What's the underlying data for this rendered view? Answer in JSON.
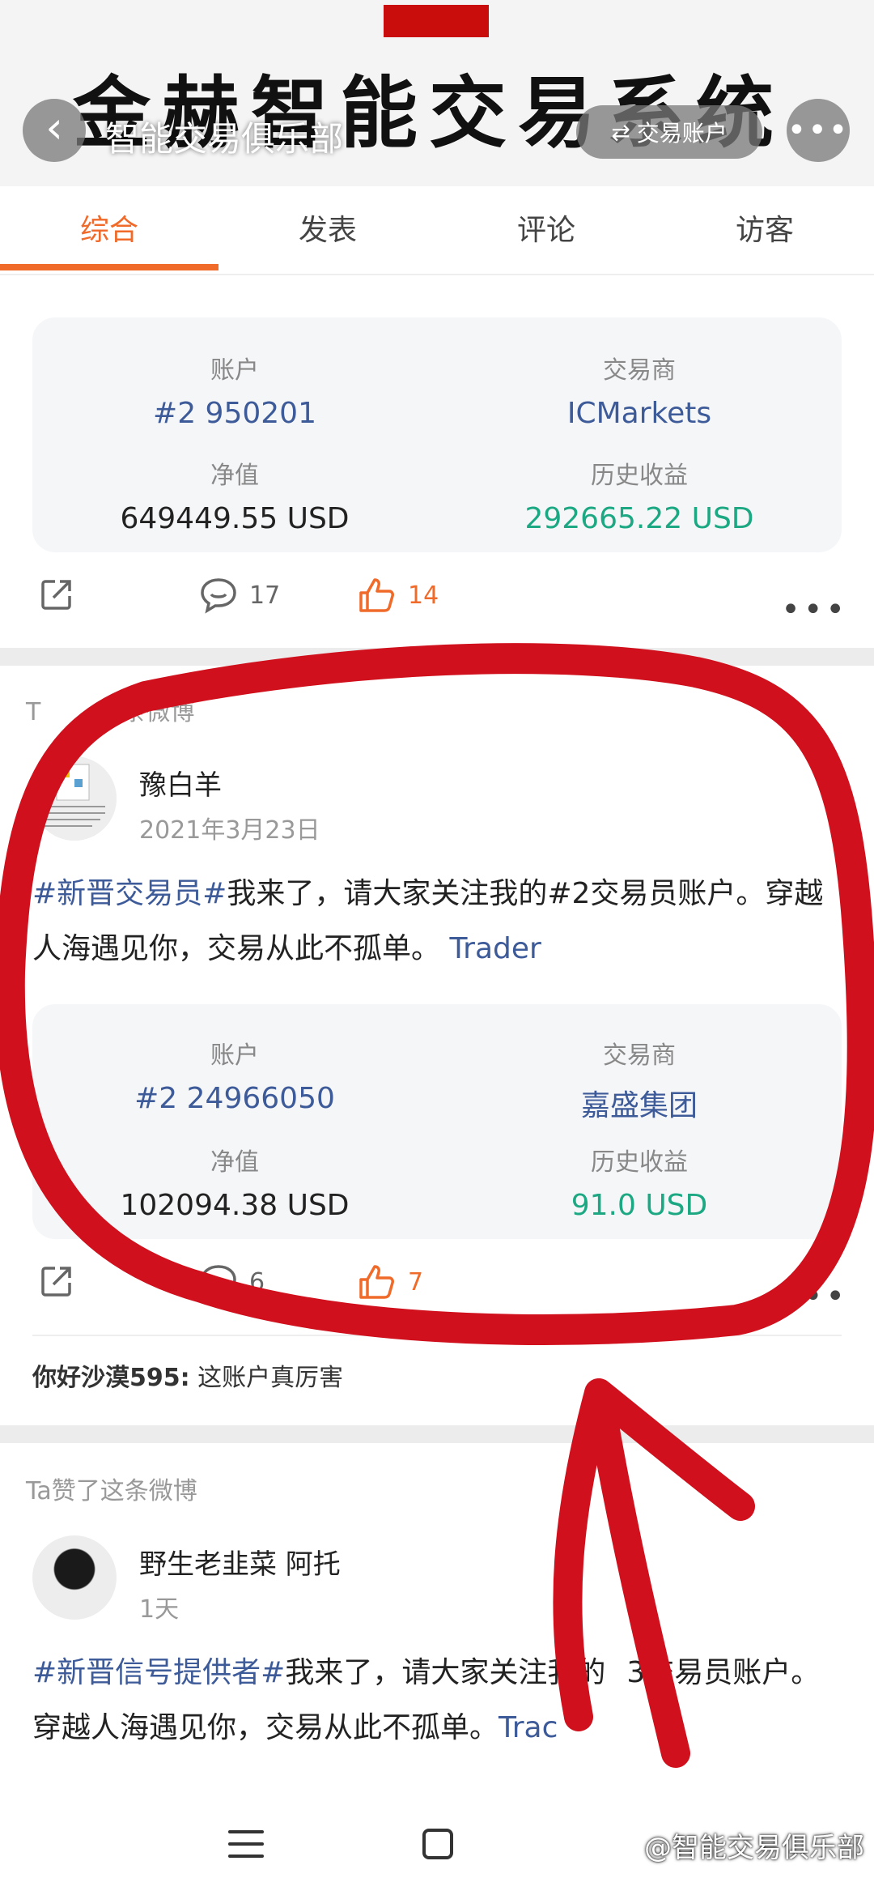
{
  "header": {
    "banner": "金赫智能交易系统",
    "title": "智能交易俱乐部",
    "switch_label": "交易账户"
  },
  "tabs": [
    "综合",
    "发表",
    "评论",
    "访客"
  ],
  "post1_card": {
    "account_label": "账户",
    "account": "#2 950201",
    "broker_label": "交易商",
    "broker": "ICMarkets",
    "equity_label": "净值",
    "equity": "649449.55 USD",
    "profit_label": "历史收益",
    "profit": "292665.22 USD"
  },
  "post1_actions": {
    "comments": "17",
    "likes": "14"
  },
  "post2": {
    "meta": "Ta赞了这条微博",
    "meta_visible_start": "T",
    "meta_visible_end": "这条微博",
    "user": "豫白羊",
    "date": "2021年3月23日",
    "tag": "#新晋交易员#",
    "text": "我来了，请大家关注我的#2交易员账户。穿越人海遇见你，交易从此不孤单。",
    "link": "Trader",
    "card": {
      "account_label": "账户",
      "account": "#2 24966050",
      "broker_label": "交易商",
      "broker": "嘉盛集团",
      "equity_label": "净值",
      "equity": "102094.38 USD",
      "profit_label": "历史收益",
      "profit": "91.0 USD"
    },
    "comments": "6",
    "likes": "7",
    "comment_user": "你好沙漠595:",
    "comment_text": "这账户真厉害"
  },
  "post3": {
    "meta": "Ta赞了这条微博",
    "user": "野生老韭菜 阿托",
    "date": "1天",
    "tag": "#新晋信号提供者#",
    "text": "我来了，请大家关注我的",
    "text2": "3交易员账户。穿越人海遇见你，交易从此不孤单。",
    "link": "Trac"
  },
  "watermark": "@智能交易俱乐部",
  "colors": {
    "accent": "#f06a2a",
    "link": "#3d5a99",
    "profit": "#1ba882",
    "annotation": "#d0101c"
  }
}
